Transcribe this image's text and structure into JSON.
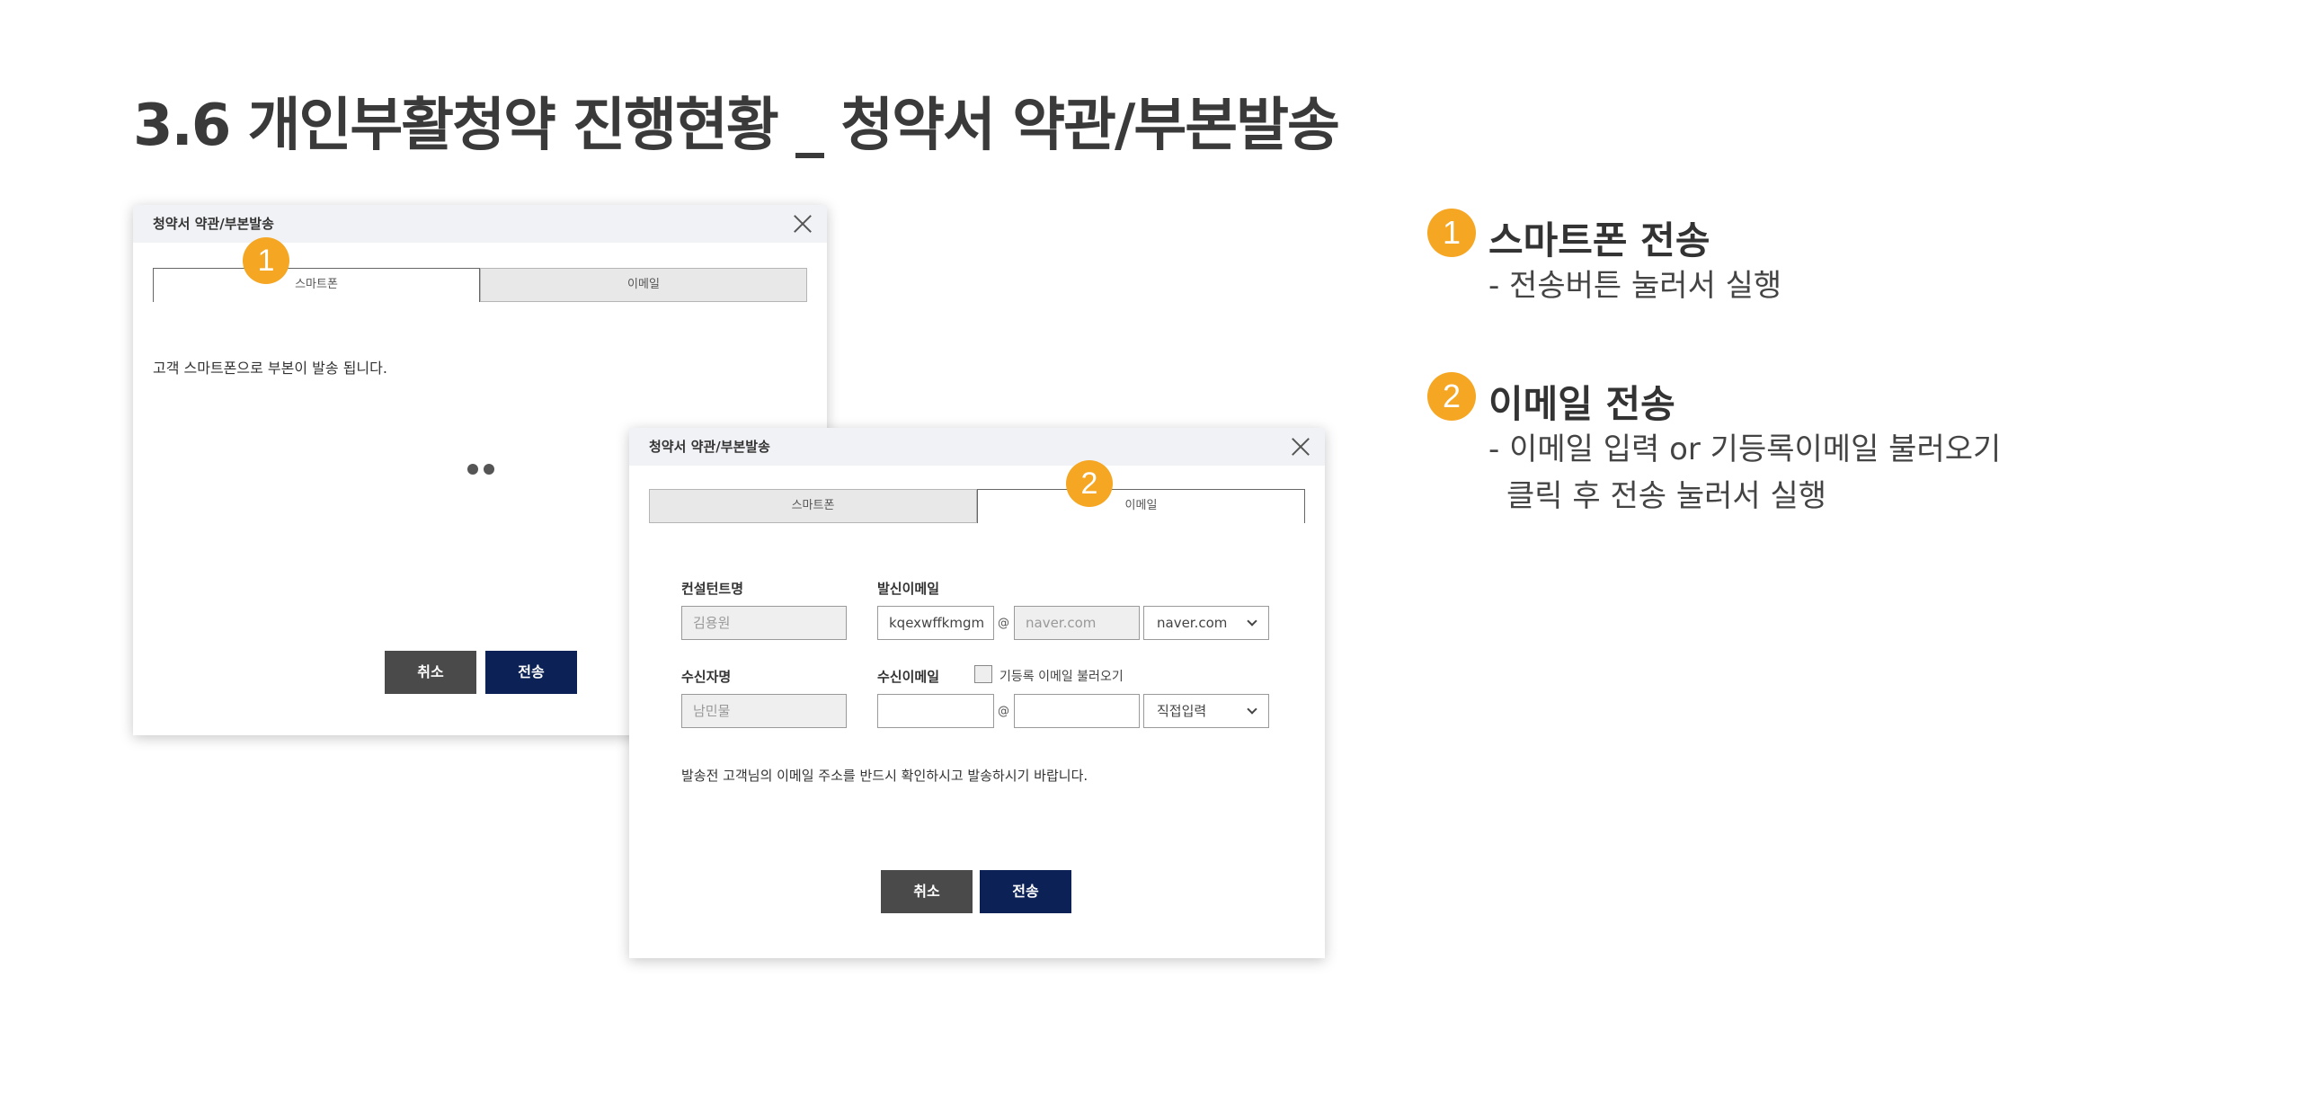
{
  "page": {
    "title": "3.6 개인부활청약 진행현황 _ 청약서 약관/부본발송"
  },
  "dialog_smartphone": {
    "title": "청약서 약관/부본발송",
    "tabs": [
      {
        "label": "스마트폰",
        "active": true
      },
      {
        "label": "이메일",
        "active": false
      }
    ],
    "badge": "1",
    "notice": "고객 스마트폰으로 부본이 발송 됩니다.",
    "cancel_label": "취소",
    "send_label": "전송"
  },
  "dialog_email": {
    "title": "청약서 약관/부본발송",
    "tabs": [
      {
        "label": "스마트폰",
        "active": false
      },
      {
        "label": "이메일",
        "active": true
      }
    ],
    "badge": "2",
    "consultant_label": "컨설턴트명",
    "consultant_value": "김용원",
    "sender_email_label": "발신이메일",
    "sender_email_id": "kqexwffkmgm",
    "at_sign": "@",
    "sender_email_domain_placeholder": "naver.com",
    "sender_email_domain_select": "naver.com",
    "recipient_label": "수신자명",
    "recipient_value": "남민물",
    "recipient_email_label": "수신이메일",
    "load_registered_label": "기등록 이메일 불러오기",
    "recipient_email_id": "",
    "recipient_email_domain": "",
    "recipient_domain_select": "직접입력",
    "footer_note": "발송전 고객님의 이메일 주소를 반드시 확인하시고 발송하시기 바랍니다.",
    "cancel_label": "취소",
    "send_label": "전송"
  },
  "legend": [
    {
      "number": "1",
      "title": "스마트폰 전송",
      "lines": [
        "- 전송버튼 눌러서 실행"
      ]
    },
    {
      "number": "2",
      "title": "이메일 전송",
      "lines": [
        "- 이메일 입력 or 기등록이메일 불러오기",
        "클릭 후 전송 눌러서 실행"
      ]
    }
  ],
  "colors": {
    "accent_badge": "#f5a623",
    "send_button": "#0c2257",
    "cancel_button": "#4a4a4a"
  }
}
